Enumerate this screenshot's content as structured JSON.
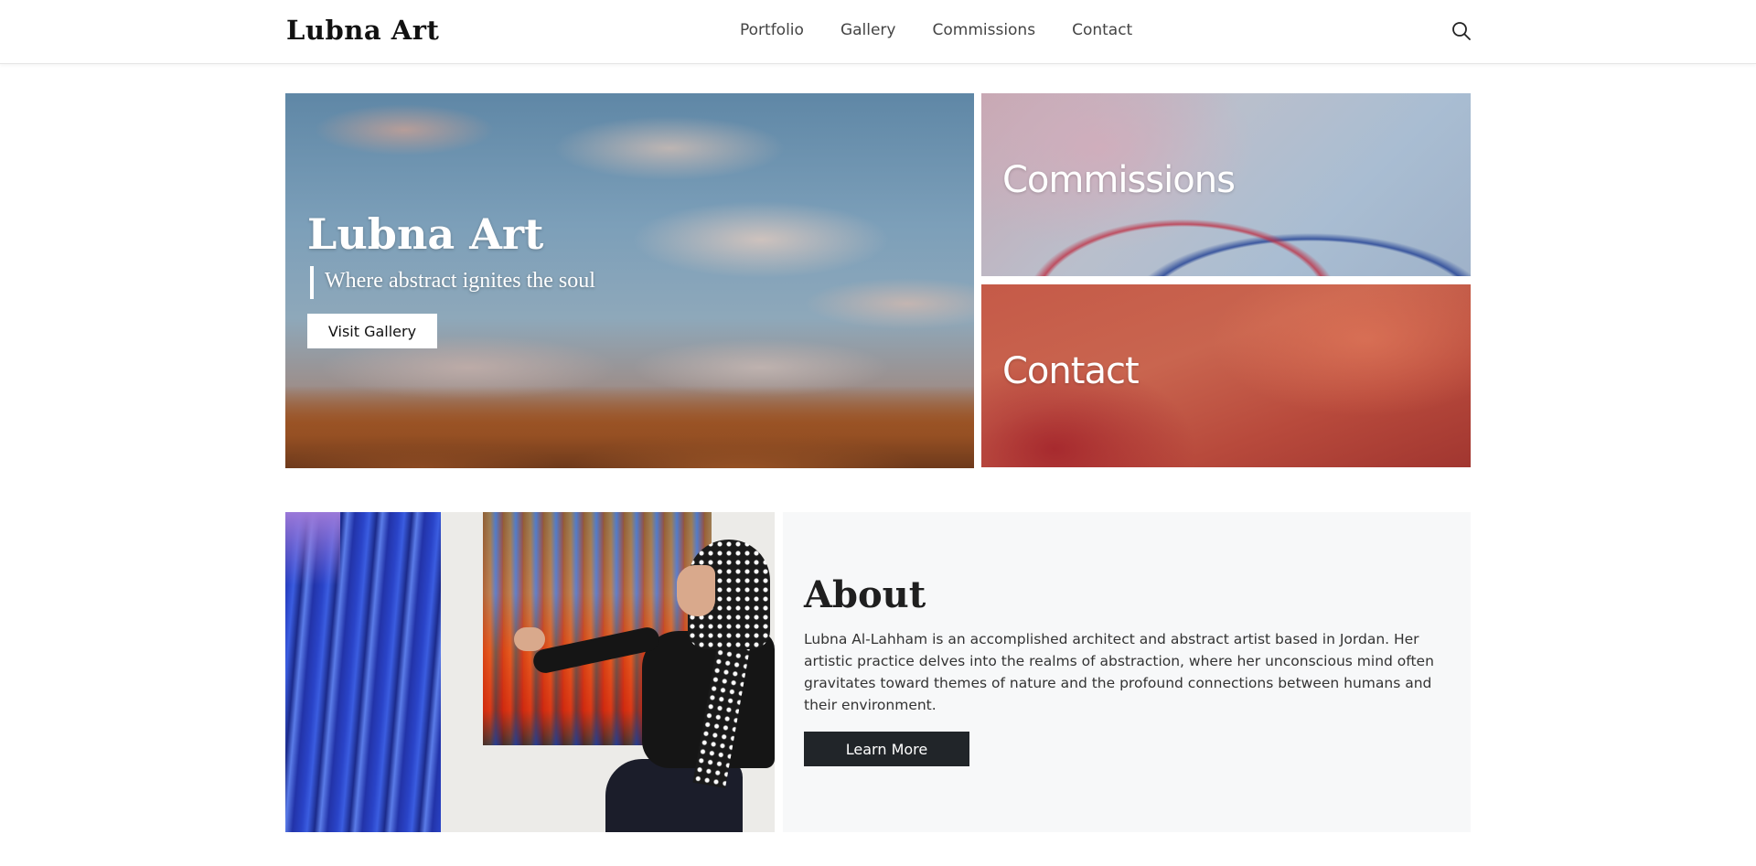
{
  "header": {
    "logo": "Lubna Art",
    "nav": [
      "Portfolio",
      "Gallery",
      "Commissions",
      "Contact"
    ],
    "search_icon": "search-icon"
  },
  "hero": {
    "title": "Lubna Art",
    "subtitle": "Where abstract ignites the soul",
    "button_label": "Visit Gallery"
  },
  "tiles": {
    "commissions": "Commissions",
    "contact": "Contact"
  },
  "about": {
    "title": "About",
    "text": "Lubna Al-Lahham is an accomplished architect and abstract artist based in Jordan. Her artistic practice delves into the realms of abstraction, where her unconscious mind often gravitates toward themes of nature and the profound connections between humans and their environment.",
    "button_label": "Learn More"
  },
  "colors": {
    "dark_button": "#212529",
    "about_bg": "#f7f8f9",
    "text_dark": "#1f1f1f"
  }
}
